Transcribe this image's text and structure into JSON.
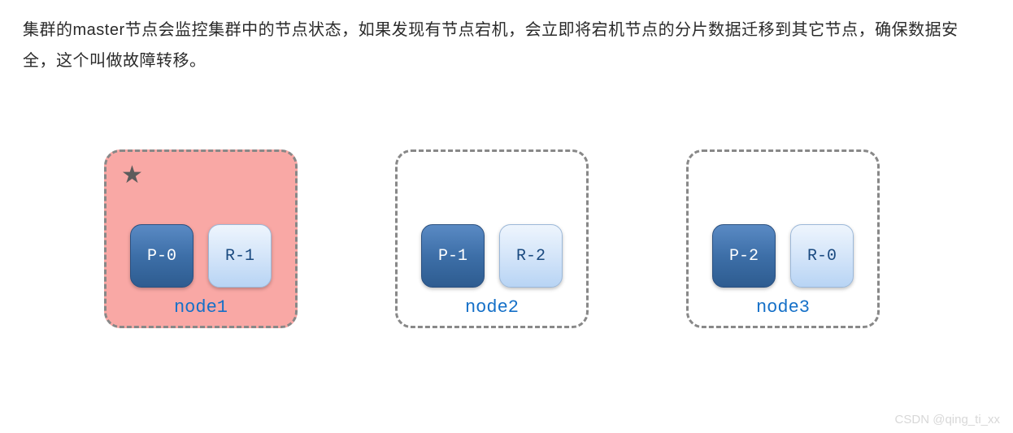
{
  "description": "集群的master节点会监控集群中的节点状态，如果发现有节点宕机，会立即将宕机节点的分片数据迁移到其它节点，确保数据安全，这个叫做故障转移。",
  "nodes": [
    {
      "label": "node1",
      "highlighted": true,
      "star": true,
      "shards": [
        {
          "name": "P-0",
          "role": "primary"
        },
        {
          "name": "R-1",
          "role": "replica"
        }
      ]
    },
    {
      "label": "node2",
      "highlighted": false,
      "star": false,
      "shards": [
        {
          "name": "P-1",
          "role": "primary"
        },
        {
          "name": "R-2",
          "role": "replica"
        }
      ]
    },
    {
      "label": "node3",
      "highlighted": false,
      "star": false,
      "shards": [
        {
          "name": "P-2",
          "role": "primary"
        },
        {
          "name": "R-0",
          "role": "replica"
        }
      ]
    }
  ],
  "watermark": "CSDN @qing_ti_xx"
}
